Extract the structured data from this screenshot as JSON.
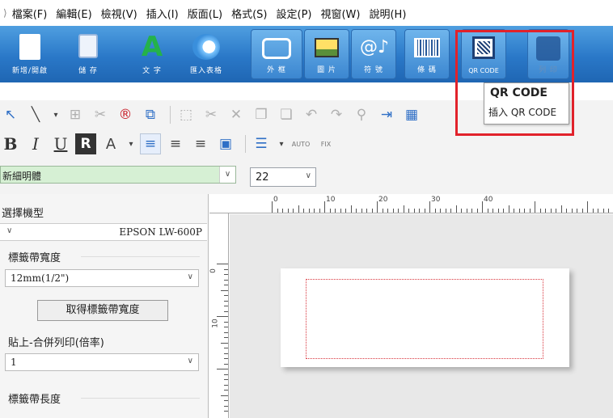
{
  "menubar": {
    "items": [
      "檔案(F)",
      "編輯(E)",
      "檢視(V)",
      "插入(I)",
      "版面(L)",
      "格式(S)",
      "設定(P)",
      "視窗(W)",
      "說明(H)"
    ]
  },
  "ribbon": {
    "new_open": "新增/開啟",
    "save": "儲 存",
    "text": "文 字",
    "import_table": "匯入表格",
    "frame": "外 框",
    "picture": "圖 片",
    "symbol": "符 號",
    "barcode": "條 碼",
    "qr_code": "QR CODE",
    "print": "列 印"
  },
  "dropdown": {
    "title": "QR CODE",
    "insert_item": "插入 QR CODE"
  },
  "format_toolbar": {
    "bold": "B",
    "italic": "I",
    "underline": "U",
    "font_color": "A",
    "auto": "AUTO",
    "fix": "FIX"
  },
  "font": {
    "family": "新細明體",
    "size": "22"
  },
  "left_panel": {
    "model_label": "選擇機型",
    "model_value": "EPSON LW-600P",
    "tape_width_label": "標籤帶寬度",
    "tape_width_value": "12mm(1/2\")",
    "get_width_button": "取得標籤帶寬度",
    "paste_label": "貼上-合併列印(倍率)",
    "paste_value": "1",
    "tape_length_label": "標籤帶長度"
  },
  "ruler": {
    "top_numbers": [
      "0",
      "10",
      "20",
      "30",
      "40"
    ],
    "left_numbers": [
      "0",
      "10"
    ]
  },
  "colors": {
    "ribbon_blue": "#2a78c8",
    "highlight_red": "#e1222b",
    "font_select_green": "#d6f0d4"
  }
}
